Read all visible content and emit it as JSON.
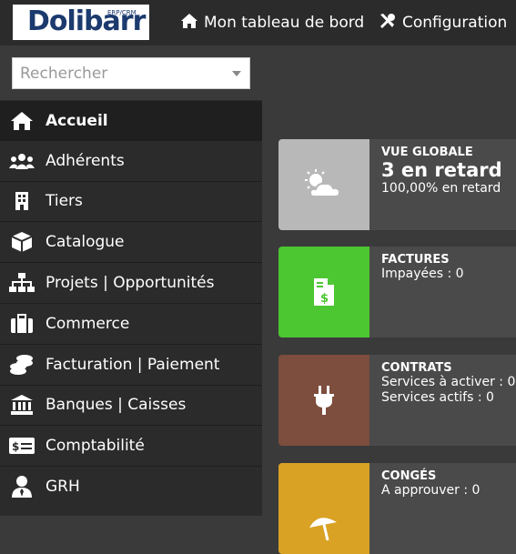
{
  "header": {
    "logo_text": "Dolibarr",
    "logo_sub": "ERP/CRM",
    "home_label": "Mon tableau de bord",
    "config_label": "Configuration"
  },
  "search": {
    "placeholder": "Rechercher"
  },
  "menu": [
    {
      "label": "Accueil",
      "icon": "home-icon",
      "active": true
    },
    {
      "label": "Adhérents",
      "icon": "users-icon"
    },
    {
      "label": "Tiers",
      "icon": "building-icon"
    },
    {
      "label": "Catalogue",
      "icon": "cube-icon"
    },
    {
      "label": "Projets | Opportunités",
      "icon": "sitemap-icon"
    },
    {
      "label": "Commerce",
      "icon": "suitcase-icon"
    },
    {
      "label": "Facturation | Paiement",
      "icon": "coins-icon"
    },
    {
      "label": "Banques | Caisses",
      "icon": "bank-icon"
    },
    {
      "label": "Comptabilité",
      "icon": "money-check-icon"
    },
    {
      "label": "GRH",
      "icon": "user-tie-icon"
    }
  ],
  "cards": [
    {
      "title": "VUE GLOBALE",
      "big": "3 en retard",
      "line1": "100,00% en retard",
      "color": "#b8b8b8",
      "icon": "cloud-sun-icon"
    },
    {
      "title": "FACTURES",
      "line1": "Impayées : 0",
      "color": "#4cc631",
      "icon": "invoice-icon"
    },
    {
      "title": "CONTRATS",
      "line1": "Services à activer : 0",
      "line2": "Services actifs : 0",
      "color": "#7d4d3d",
      "icon": "plug-icon"
    },
    {
      "title": "CONGÉS",
      "line1": "A approuver : 0",
      "color": "#d9a224",
      "icon": "umbrella-beach-icon"
    }
  ]
}
